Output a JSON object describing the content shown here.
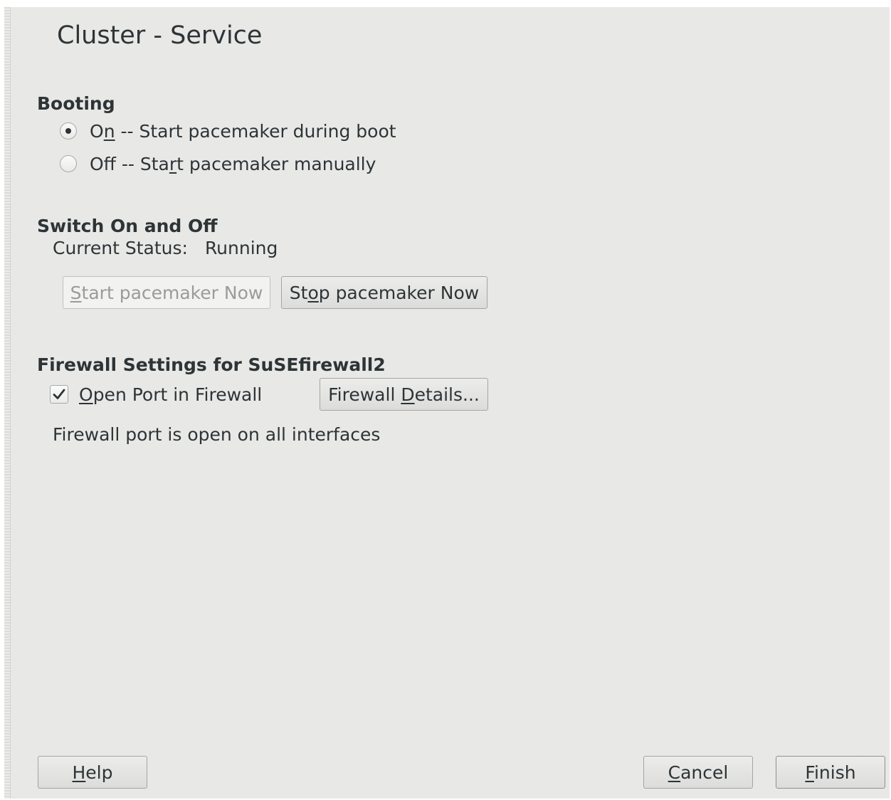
{
  "title": "Cluster - Service",
  "booting": {
    "heading": "Booting",
    "options": [
      {
        "accel": "O",
        "mnemonic": "n",
        "rest": " -- Start pacemaker during boot",
        "checked": true
      },
      {
        "accel": "Off -- Sta",
        "mnemonic": "r",
        "rest": "t pacemaker manually",
        "checked": false
      }
    ]
  },
  "switch": {
    "heading": "Switch On and Off",
    "status_label": "Current Status:",
    "status_value": "Running",
    "start_button": {
      "pre": "",
      "mnemonic": "S",
      "post": "tart pacemaker Now",
      "enabled": false
    },
    "stop_button": {
      "pre": "St",
      "mnemonic": "o",
      "post": "p pacemaker Now",
      "enabled": true
    }
  },
  "firewall": {
    "heading": "Firewall Settings for SuSEfirewall2",
    "checkbox": {
      "pre": "",
      "mnemonic": "O",
      "post": "pen Port in Firewall",
      "checked": true
    },
    "details_button": {
      "pre": "Firewall ",
      "mnemonic": "D",
      "post": "etails..."
    },
    "info": "Firewall port is open on all interfaces"
  },
  "footer": {
    "help": {
      "mnemonic": "H",
      "post": "elp"
    },
    "cancel": {
      "mnemonic": "C",
      "post": "ancel"
    },
    "finish": {
      "mnemonic": "F",
      "post": "inish"
    }
  },
  "icons": {
    "radio": "radio-button",
    "checkbox": "checkmark-icon"
  }
}
